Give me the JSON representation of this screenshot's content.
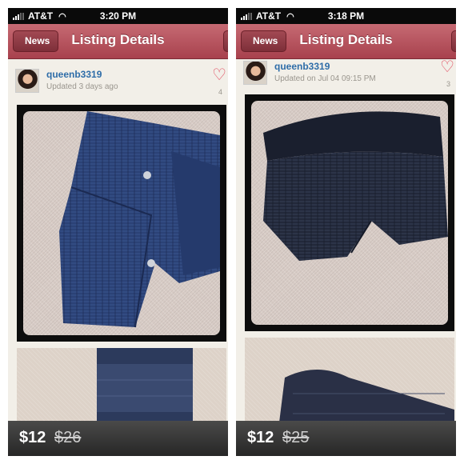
{
  "screens": [
    {
      "status": {
        "carrier": "AT&T",
        "time": "3:20 PM"
      },
      "nav": {
        "back_label": "News",
        "title": "Listing Details"
      },
      "listing": {
        "username": "queenb3319",
        "updated": "Updated 3 days ago",
        "likes": "4",
        "price": "$12",
        "original_price": "$26"
      }
    },
    {
      "status": {
        "carrier": "AT&T",
        "time": "3:18 PM"
      },
      "nav": {
        "back_label": "News",
        "title": "Listing Details"
      },
      "listing": {
        "username": "queenb3319",
        "updated": "Updated on Jul 04 09:15 PM",
        "likes": "3",
        "price": "$12",
        "original_price": "$25"
      }
    }
  ],
  "icons": {
    "signal": "signal-bars-icon",
    "wifi": "wifi-icon",
    "heart": "heart-icon",
    "back": "chevron-left-icon"
  },
  "colors": {
    "navbar": "#b04e5a",
    "username": "#2e6da8",
    "heart": "#e1475c",
    "shorts": "#2c3e6e"
  }
}
